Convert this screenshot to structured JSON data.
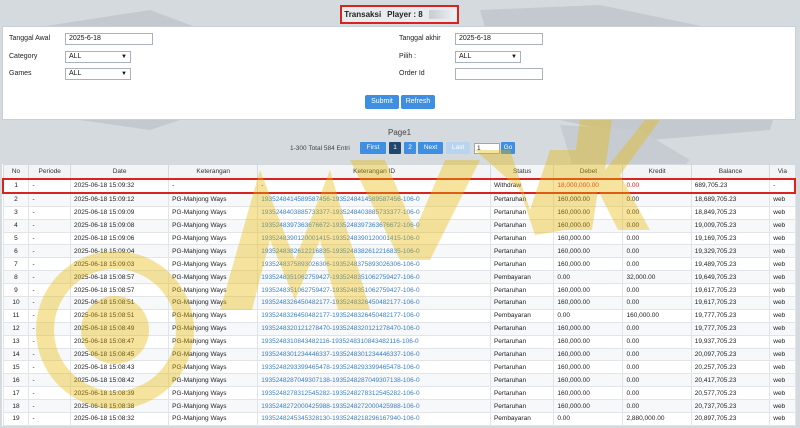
{
  "header": {
    "title": "Transaksi",
    "player_label": "Player : 8"
  },
  "filters": {
    "tanggal_awal_label": "Tanggal Awal",
    "tanggal_awal_value": "2025-6-18",
    "tanggal_akhir_label": "Tanggal akhir",
    "tanggal_akhir_value": "2025-6-18",
    "category_label": "Category",
    "category_value": "ALL",
    "pilih_label": "Pilih  :",
    "pilih_value": "ALL",
    "games_label": "Games",
    "games_value": "ALL",
    "order_id_label": "Order Id",
    "order_id_value": "",
    "submit_label": "Submit",
    "refresh_label": "Refresh"
  },
  "pagination": {
    "page_label": "Page1",
    "summary": "1-300 Total 584 Entri",
    "first": "First",
    "page1": "1",
    "page2": "2",
    "next": "Next",
    "last": "Last",
    "page_input": "1",
    "go": "Go"
  },
  "table": {
    "headers": [
      "No",
      "Periode",
      "Date",
      "Keterangan",
      "Keterangan ID",
      "Status",
      "Debet",
      "Kredit",
      "Balance",
      "Via"
    ],
    "rows": [
      [
        "1",
        "-",
        "2025-06-18 15:09:32",
        "-",
        "-",
        "Withdraw",
        "18,000,000.00",
        "0.00",
        "689,705.23",
        "-"
      ],
      [
        "2",
        "-",
        "2025-06-18 15:09:12",
        "PG-Mahjong Ways",
        "1935248414589587456-1935248414589587456-106-0",
        "Pertaruhan",
        "160,000.00",
        "0.00",
        "18,689,705.23",
        "web"
      ],
      [
        "3",
        "-",
        "2025-06-18 15:09:09",
        "PG-Mahjong Ways",
        "1935248403885733377-1935248403885733377-106-0",
        "Pertaruhan",
        "160,000.00",
        "0.00",
        "18,849,705.23",
        "web"
      ],
      [
        "4",
        "-",
        "2025-06-18 15:09:08",
        "PG-Mahjong Ways",
        "1935248397363676672-1935248397363676672-106-0",
        "Pertaruhan",
        "160,000.00",
        "0.00",
        "19,009,705.23",
        "web"
      ],
      [
        "5",
        "-",
        "2025-06-18 15:09:06",
        "PG-Mahjong Ways",
        "1935248390120001415-1935248390120001415-106-0",
        "Pertaruhan",
        "160,000.00",
        "0.00",
        "19,169,705.23",
        "web"
      ],
      [
        "6",
        "-",
        "2025-06-18 15:09:04",
        "PG-Mahjong Ways",
        "1935248382612216835-1935248382612216835-106-0",
        "Pertaruhan",
        "160,000.00",
        "0.00",
        "19,329,705.23",
        "web"
      ],
      [
        "7",
        "-",
        "2025-06-18 15:09:03",
        "PG-Mahjong Ways",
        "1935248375893026306-1935248375893026306-106-0",
        "Pertaruhan",
        "160,000.00",
        "0.00",
        "19,489,705.23",
        "web"
      ],
      [
        "8",
        "-",
        "2025-06-18 15:08:57",
        "PG-Mahjong Ways",
        "1935248351062759427-1935248351062759427-106-0",
        "Pembayaran",
        "0.00",
        "32,000.00",
        "19,649,705.23",
        "web"
      ],
      [
        "9",
        "-",
        "2025-06-18 15:08:57",
        "PG-Mahjong Ways",
        "1935248351062759427-1935248351062759427-106-0",
        "Pertaruhan",
        "160,000.00",
        "0.00",
        "19,617,705.23",
        "web"
      ],
      [
        "10",
        "-",
        "2025-06-18 15:08:51",
        "PG-Mahjong Ways",
        "1935248326450482177-1935248326450482177-106-0",
        "Pertaruhan",
        "160,000.00",
        "0.00",
        "19,617,705.23",
        "web"
      ],
      [
        "11",
        "-",
        "2025-06-18 15:08:51",
        "PG-Mahjong Ways",
        "1935248326450482177-1935248326450482177-106-0",
        "Pembayaran",
        "0.00",
        "160,000.00",
        "19,777,705.23",
        "web"
      ],
      [
        "12",
        "-",
        "2025-06-18 15:08:49",
        "PG-Mahjong Ways",
        "1935248320121278470-1935248320121278470-106-0",
        "Pertaruhan",
        "160,000.00",
        "0.00",
        "19,777,705.23",
        "web"
      ],
      [
        "13",
        "-",
        "2025-06-18 15:08:47",
        "PG-Mahjong Ways",
        "1935248310843482116-1935248310843482116-106-0",
        "Pertaruhan",
        "160,000.00",
        "0.00",
        "19,937,705.23",
        "web"
      ],
      [
        "14",
        "-",
        "2025-06-18 15:08:45",
        "PG-Mahjong Ways",
        "1935248301234446337-1935248301234446337-106-0",
        "Pertaruhan",
        "160,000.00",
        "0.00",
        "20,097,705.23",
        "web"
      ],
      [
        "15",
        "-",
        "2025-06-18 15:08:43",
        "PG-Mahjong Ways",
        "1935248293399465478-1935248293399465478-106-0",
        "Pertaruhan",
        "160,000.00",
        "0.00",
        "20,257,705.23",
        "web"
      ],
      [
        "16",
        "-",
        "2025-06-18 15:08:42",
        "PG-Mahjong Ways",
        "1935248287049307138-1935248287049307138-106-0",
        "Pertaruhan",
        "160,000.00",
        "0.00",
        "20,417,705.23",
        "web"
      ],
      [
        "17",
        "-",
        "2025-06-18 15:08:39",
        "PG-Mahjong Ways",
        "1935248278312545282-1935248278312545282-106-0",
        "Pertaruhan",
        "160,000.00",
        "0.00",
        "20,577,705.23",
        "web"
      ],
      [
        "18",
        "-",
        "2025-06-18 15:08:38",
        "PG-Mahjong Ways",
        "1935248272000425988-1935248272000425988-106-0",
        "Pertaruhan",
        "160,000.00",
        "0.00",
        "20,737,705.23",
        "web"
      ],
      [
        "19",
        "-",
        "2025-06-18 15:08:32",
        "PG-Mahjong Ways",
        "1935248245345328130-1935248218296167940-106-0",
        "Pembayaran",
        "0.00",
        "2,880,000.00",
        "20,897,705.23",
        "web"
      ]
    ]
  }
}
